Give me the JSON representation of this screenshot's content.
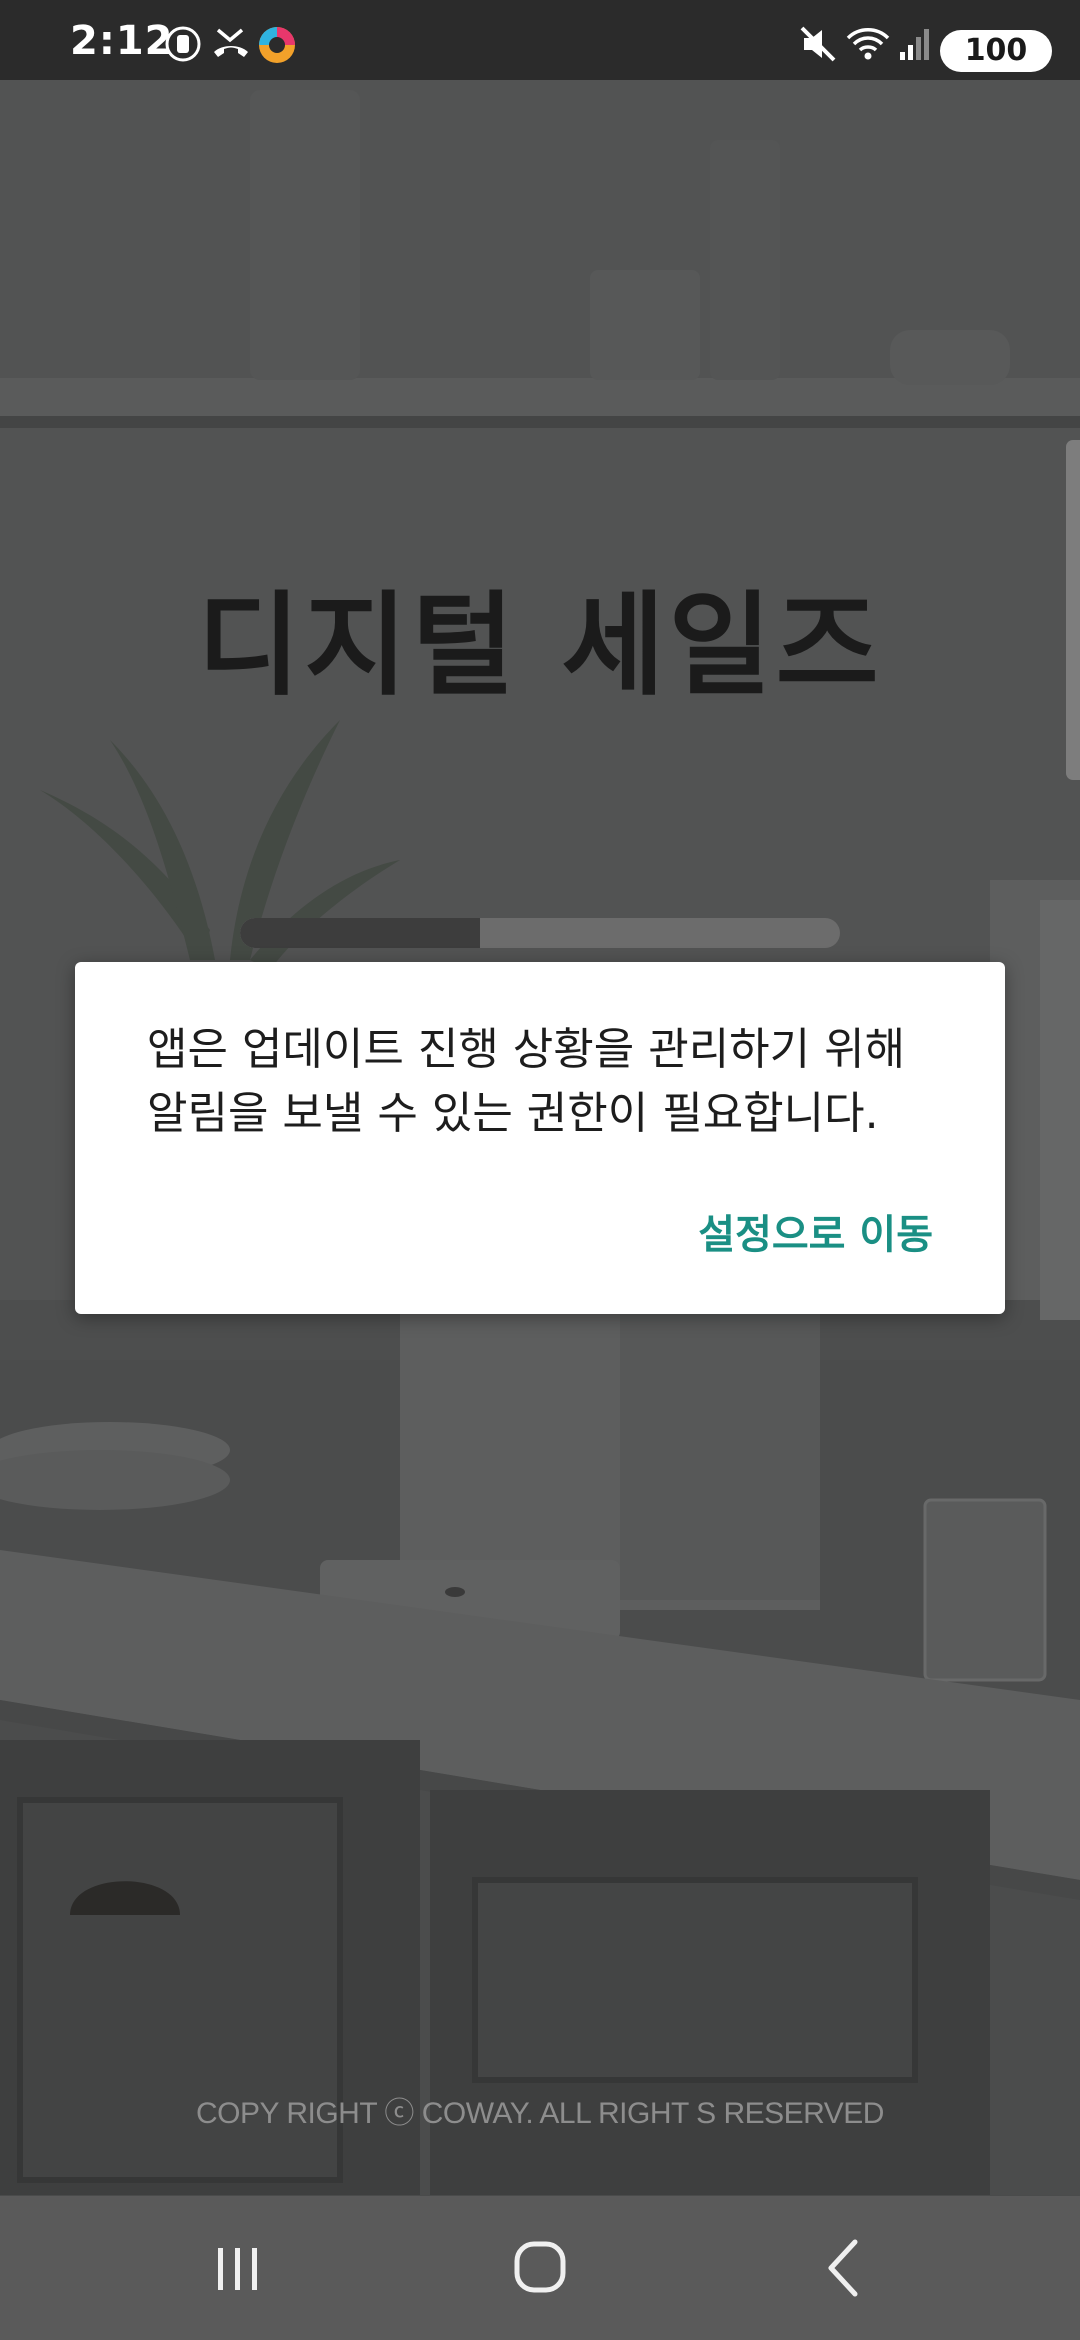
{
  "status_bar": {
    "time": "2:12",
    "battery": "100",
    "left_icons": [
      "screen-record-icon",
      "missed-call-icon",
      "app-notification-icon"
    ],
    "right_icons": [
      "mute-icon",
      "wifi-icon",
      "signal-icon"
    ]
  },
  "app": {
    "title": "디지털 세일즈",
    "progress": 0.4,
    "copyright": "COPY RIGHT ⓒ COWAY.  ALL RIGHT S RESERVED"
  },
  "dialog": {
    "message_line1": "앱은 업데이트 진행 상황을 관리하기 위해",
    "message_line2": "알림을 보낼 수 있는 권한이 필요합니다.",
    "action_label": "설정으로 이동",
    "accent_color": "#1a8f84"
  },
  "nav_bar": {
    "buttons": [
      "recents-icon",
      "home-icon",
      "back-icon"
    ]
  }
}
